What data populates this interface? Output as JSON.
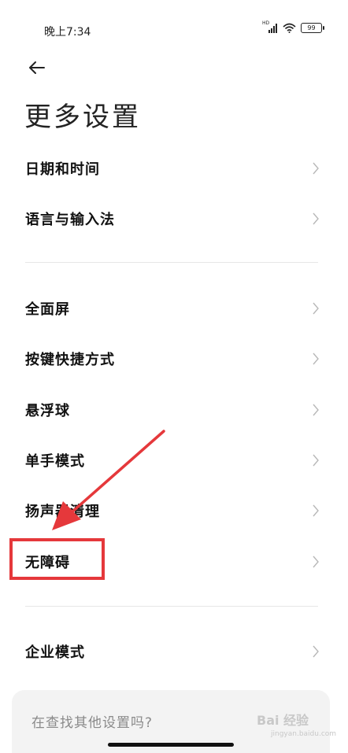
{
  "status_bar": {
    "time": "晚上7:34",
    "signal_label": "HD",
    "battery": "99"
  },
  "header": {
    "title": "更多设置"
  },
  "groups": [
    {
      "items": [
        {
          "label": "日期和时间"
        },
        {
          "label": "语言与输入法"
        }
      ]
    },
    {
      "items": [
        {
          "label": "全面屏"
        },
        {
          "label": "按键快捷方式"
        },
        {
          "label": "悬浮球"
        },
        {
          "label": "单手模式"
        },
        {
          "label": "扬声器清理"
        },
        {
          "label": "无障碍"
        }
      ]
    },
    {
      "items": [
        {
          "label": "企业模式"
        }
      ]
    }
  ],
  "search_prompt": {
    "text": "在查找其他设置吗?"
  },
  "annotation": {
    "highlighted_item": "无障碍",
    "color": "#e5383b"
  },
  "watermark": {
    "text": "Bai 经验",
    "sub": "jingyan.baidu.com"
  }
}
